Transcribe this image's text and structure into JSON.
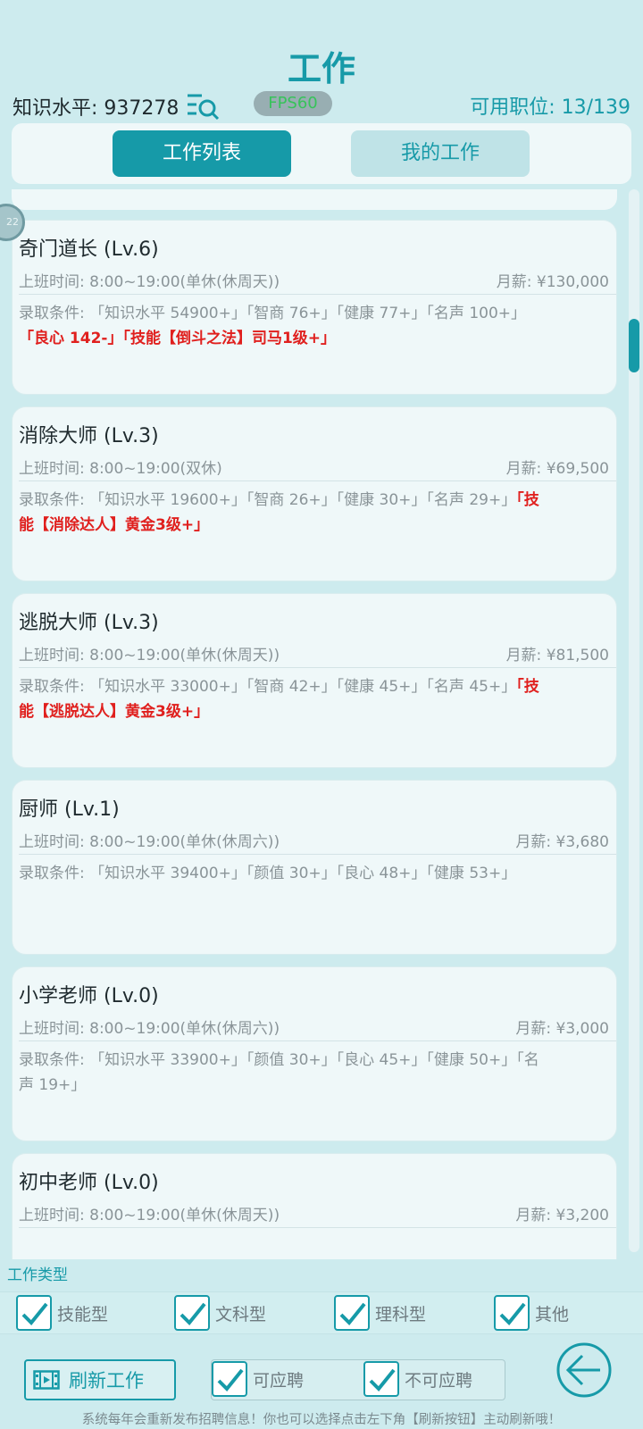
{
  "header": {
    "title": "工作",
    "knowledge_label": "知识水平: 937278",
    "fps_badge": "FPS60",
    "positions_label": "可用职位: 13/139"
  },
  "tabs": [
    {
      "label": "工作列表",
      "active": true
    },
    {
      "label": "我的工作",
      "active": false
    }
  ],
  "side_bubble": "22",
  "jobs": [
    {
      "name": "奇门道长 (Lv.6)",
      "time": "上班时间: 8:00~19:00(单休(休周天))",
      "salary": "月薪: ¥130,000",
      "req_prefix": "录取条件: 「知识水平 54900+」「智商 76+」「健康 77+」「名声 100+」",
      "req_red": "「良心 142-」「技能【倒斗之法】司马1级+」"
    },
    {
      "name": "消除大师 (Lv.3)",
      "time": "上班时间: 8:00~19:00(双休)",
      "salary": "月薪: ¥69,500",
      "req_prefix": "录取条件: 「知识水平 19600+」「智商 26+」「健康 30+」「名声 29+」",
      "req_red": "「技能【消除达人】黄金3级+」"
    },
    {
      "name": "逃脱大师 (Lv.3)",
      "time": "上班时间: 8:00~19:00(单休(休周天))",
      "salary": "月薪: ¥81,500",
      "req_prefix": "录取条件: 「知识水平 33000+」「智商 42+」「健康 45+」「名声 45+」",
      "req_red": "「技能【逃脱达人】黄金3级+」"
    },
    {
      "name": "厨师 (Lv.1)",
      "time": "上班时间: 8:00~19:00(单休(休周六))",
      "salary": "月薪: ¥3,680",
      "req_prefix": "录取条件: 「知识水平 39400+」「颜值 30+」「良心 48+」「健康 53+」",
      "req_red": ""
    },
    {
      "name": "小学老师 (Lv.0)",
      "time": "上班时间: 8:00~19:00(单休(休周六))",
      "salary": "月薪: ¥3,000",
      "req_prefix": "录取条件: 「知识水平 33900+」「颜值 30+」「良心 45+」「健康 50+」「名声 19+」",
      "req_red": ""
    },
    {
      "name": "初中老师 (Lv.0)",
      "time": "上班时间: 8:00~19:00(单休(休周天))",
      "salary": "月薪: ¥3,200",
      "req_prefix": "",
      "req_red": ""
    }
  ],
  "filter": {
    "label": "工作类型",
    "types": [
      "技能型",
      "文科型",
      "理科型",
      "其他"
    ]
  },
  "bottom": {
    "refresh_label": "刷新工作",
    "available_label": "可应聘",
    "unavailable_label": "不可应聘",
    "tip": "系统每年会重新发布招聘信息！你也可以选择点击左下角【刷新按钮】主动刷新哦！"
  },
  "colors": {
    "accent": "#169aa8",
    "background": "#cdebee",
    "card": "#eff8f9",
    "requirement_red": "#e0201e"
  },
  "icons": [
    "search-icon",
    "check-icon",
    "film-icon",
    "back-arrow-icon"
  ]
}
